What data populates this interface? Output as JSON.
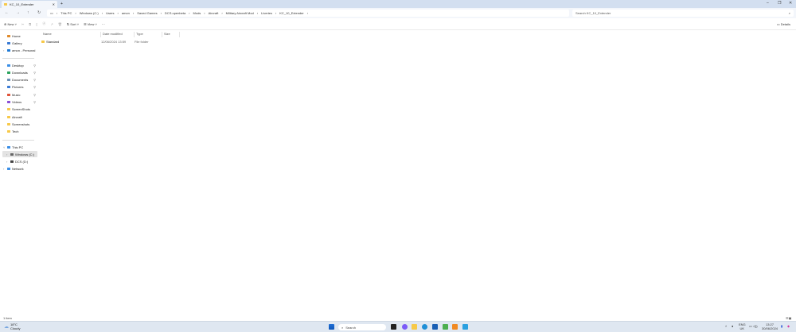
{
  "window": {
    "tab_title": "KC_10_Extender",
    "new_tab": "+",
    "minimize": "–",
    "maximize": "❐",
    "close": "✕"
  },
  "address": {
    "segments": [
      "This PC",
      "Windows (C:)",
      "Users",
      "amon",
      "Saved Games",
      "DCS.openbeta",
      "Mods",
      "Aircraft",
      "Military Aircraft Mod",
      "Liveries",
      "KC_10_Extender"
    ],
    "search_placeholder": "Search KC_10_Extender"
  },
  "toolbar": {
    "new": "New",
    "sort": "Sort",
    "view": "View",
    "more": "···",
    "details": "Details"
  },
  "sidebar": {
    "top": [
      {
        "label": "Home"
      },
      {
        "label": "Gallery"
      },
      {
        "label": "amon - Personal"
      }
    ],
    "quick": [
      {
        "label": "Desktop",
        "pinned": true,
        "color": "#3a8ee6"
      },
      {
        "label": "Downloads",
        "pinned": true,
        "color": "#2aa35d"
      },
      {
        "label": "Documents",
        "pinned": true,
        "color": "#6b8fb5"
      },
      {
        "label": "Pictures",
        "pinned": true,
        "color": "#3a7bd5"
      },
      {
        "label": "Music",
        "pinned": true,
        "color": "#e0533a"
      },
      {
        "label": "Videos",
        "pinned": true,
        "color": "#8a4fd6"
      },
      {
        "label": "ScreenShots",
        "pinned": false,
        "color": "#f7c948"
      },
      {
        "label": "Aircraft",
        "pinned": false,
        "color": "#f7c948"
      },
      {
        "label": "Screenshots",
        "pinned": false,
        "color": "#f7c948"
      },
      {
        "label": "Tech",
        "pinned": false,
        "color": "#f7c948"
      }
    ],
    "drives": [
      {
        "label": "This PC"
      },
      {
        "label": "Windows (C:)"
      },
      {
        "label": "DCS (D:)"
      },
      {
        "label": "Network"
      }
    ]
  },
  "columns": [
    "Name",
    "Date modified",
    "Type",
    "Size"
  ],
  "files": [
    {
      "name": "Standard",
      "date": "12/06/2024 13:59",
      "type": "File folder",
      "size": ""
    }
  ],
  "status": "1 item",
  "taskbar": {
    "weather_temp": "18°C",
    "weather_desc": "Cloudy",
    "search": "Search",
    "lang1": "ENG",
    "lang2": "UK",
    "time": "13:27",
    "date": "30/06/2024"
  }
}
